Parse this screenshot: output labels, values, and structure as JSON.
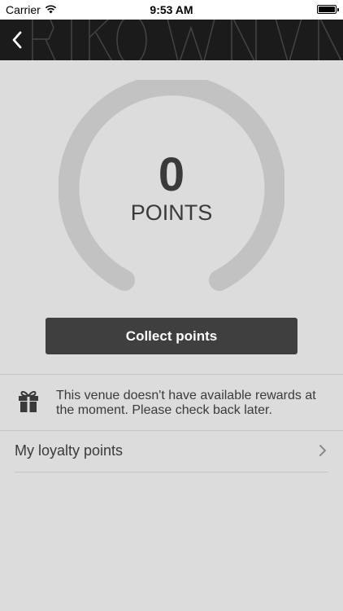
{
  "status_bar": {
    "carrier": "Carrier",
    "time": "9:53 AM"
  },
  "nav": {
    "back_icon": "chevron-left-icon"
  },
  "loyalty": {
    "points_value": "0",
    "points_label": "POINTS",
    "gauge_progress": 0
  },
  "actions": {
    "collect_label": "Collect points"
  },
  "rewards": {
    "icon": "gift-icon",
    "message": "This venue doesn't have available rewards at the moment. Please check back later."
  },
  "menu": {
    "loyalty_points_label": "My loyalty points"
  },
  "colors": {
    "button": "#3f3f3f",
    "background": "#dcdcdc",
    "gauge_track": "#c2c2c2"
  }
}
